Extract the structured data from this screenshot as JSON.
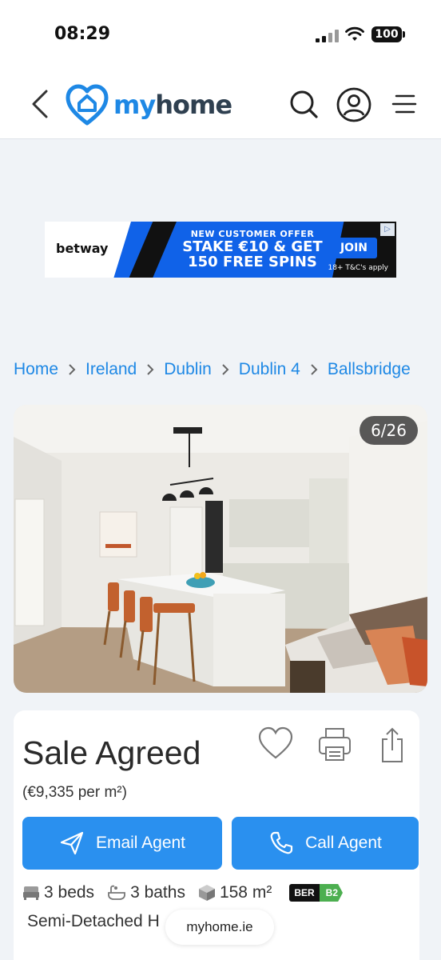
{
  "status_bar": {
    "time": "08:29",
    "battery": "100"
  },
  "header": {
    "logo_my": "my",
    "logo_home": "home"
  },
  "ad": {
    "brand": "betway",
    "offer": "NEW CUSTOMER OFFER",
    "headline_1": "STAKE €10 & GET",
    "headline_2": "150 FREE SPINS",
    "cta": "JOIN",
    "terms": "18+ T&C's apply",
    "adchoices": "▷"
  },
  "breadcrumb": [
    "Home",
    "Ireland",
    "Dublin",
    "Dublin 4",
    "Ballsbridge"
  ],
  "gallery": {
    "counter": "6/26"
  },
  "listing": {
    "status": "Sale Agreed",
    "price_per_m2": "(€9,335 per m²)",
    "email_button": "Email Agent",
    "call_button": "Call Agent",
    "beds": "3 beds",
    "baths": "3 baths",
    "area": "158 m²",
    "ber_label": "BER",
    "ber_rating": "B2",
    "property_type": "Semi-Detached H"
  },
  "browser": {
    "url": "myhome.ie"
  }
}
